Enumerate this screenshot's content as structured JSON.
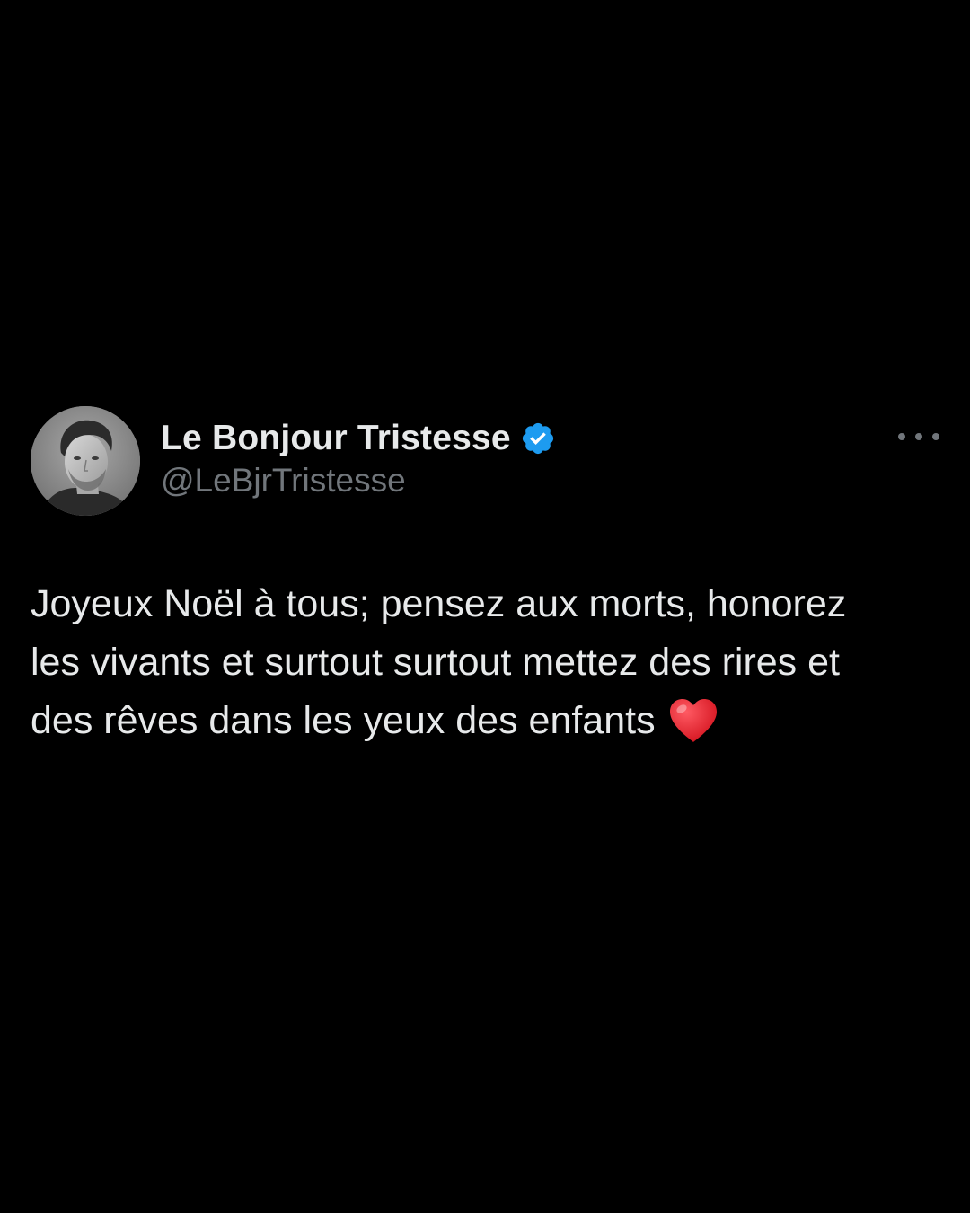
{
  "tweet": {
    "author": {
      "display_name": "Le Bonjour Tristesse",
      "handle": "@LeBjrTristesse",
      "verified": true,
      "avatar": "profile-photo"
    },
    "more_icon": "ellipsis-icon",
    "text": "Joyeux Noël à tous; pensez aux morts, honorez\nles vivants et surtout surtout mettez des rires et\ndes rêves dans les yeux des enfants",
    "emoji": "red-heart-icon"
  },
  "colors": {
    "background": "#000000",
    "primary_text": "#e7e9ea",
    "secondary_text": "#71767b",
    "verified_badge": "#1d9bf0",
    "heart": "#e0202e"
  }
}
